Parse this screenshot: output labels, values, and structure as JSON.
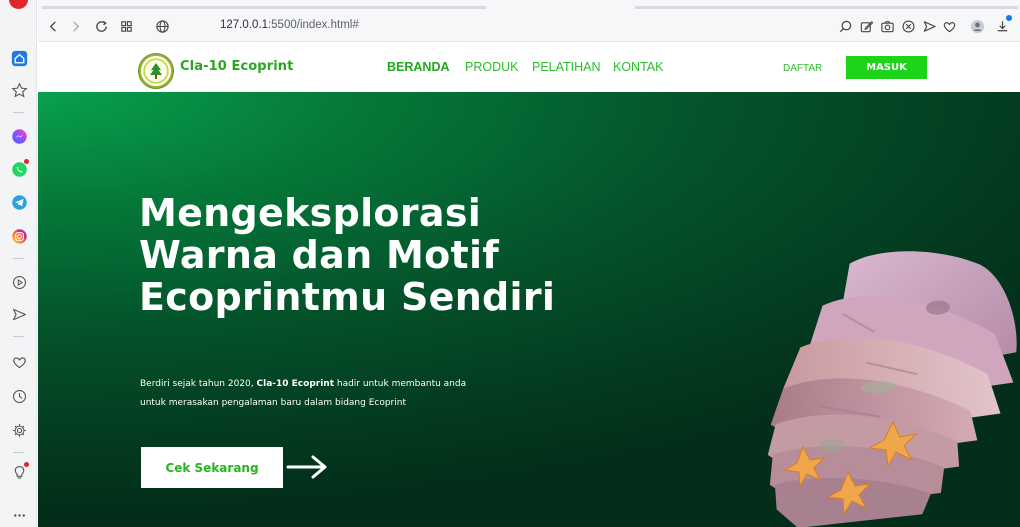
{
  "browser": {
    "url_host": "127.0.0.1",
    "url_path": ":5500/index.html#"
  },
  "site": {
    "brand": "Cla-10 Ecoprint",
    "nav": [
      "BERANDA",
      "PRODUK",
      "PELATIHAN",
      "KONTAK"
    ],
    "active_nav": "BERANDA",
    "register_label": "DAFTAR",
    "login_label": "MASUK"
  },
  "hero": {
    "headline": "Mengeksplorasi Warna dan Motif Ecoprintmu Sendiri",
    "desc_before": "Berdiri sejak tahun 2020, ",
    "desc_brand": "Cla-10 Ecoprint",
    "desc_after": " hadir untuk membantu anda untuk merasakan pengalaman baru dalam bidang Ecoprint",
    "cta_label": "Cek Sekarang"
  },
  "colors": {
    "brand_green": "#23a81d",
    "button_green": "#1ed41b",
    "hero_dark": "#033a1f"
  },
  "icons": {
    "sidebar": [
      "opera-logo-icon",
      "home-icon",
      "star-icon",
      "messenger-icon",
      "whatsapp-icon",
      "telegram-icon",
      "instagram-icon",
      "player-icon",
      "send-icon",
      "heart-icon",
      "history-icon",
      "settings-icon",
      "lightbulb-icon",
      "more-icon"
    ],
    "toolbar": [
      "back-icon",
      "forward-icon",
      "reload-icon",
      "speed-dial-icon",
      "globe-icon",
      "search-icon",
      "edit-icon",
      "camera-icon",
      "block-icon",
      "send-icon",
      "heart-icon",
      "profile-icon",
      "download-icon"
    ]
  }
}
